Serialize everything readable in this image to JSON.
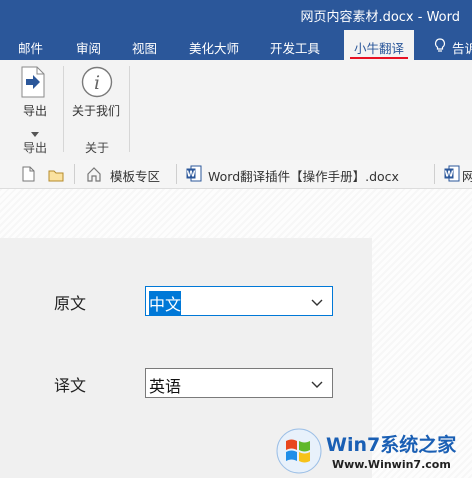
{
  "window": {
    "title": "网页内容素材.docx - Word"
  },
  "tabs": [
    {
      "label": "邮件"
    },
    {
      "label": "审阅"
    },
    {
      "label": "视图"
    },
    {
      "label": "美化大师"
    },
    {
      "label": "开发工具"
    },
    {
      "label": "小牛翻译",
      "active": true
    },
    {
      "label": "告诉"
    }
  ],
  "ribbon": {
    "groups": [
      {
        "button": "导出",
        "label": "导出"
      },
      {
        "button": "关于我们",
        "label": "关于"
      }
    ]
  },
  "docbar": {
    "template_area": "模板专区",
    "doc_tab": "Word翻译插件【操作手册】.docx",
    "next_tab_fragment": "网"
  },
  "dialog": {
    "source_label": "原文",
    "source_value": "中文",
    "target_label": "译文",
    "target_value": "英语"
  },
  "watermark": {
    "text": "Win7系统之家",
    "url": "Www.Winwin7.com"
  },
  "colors": {
    "accent": "#2b579a",
    "active_underline": "#e81123",
    "selection": "#0078d7"
  }
}
